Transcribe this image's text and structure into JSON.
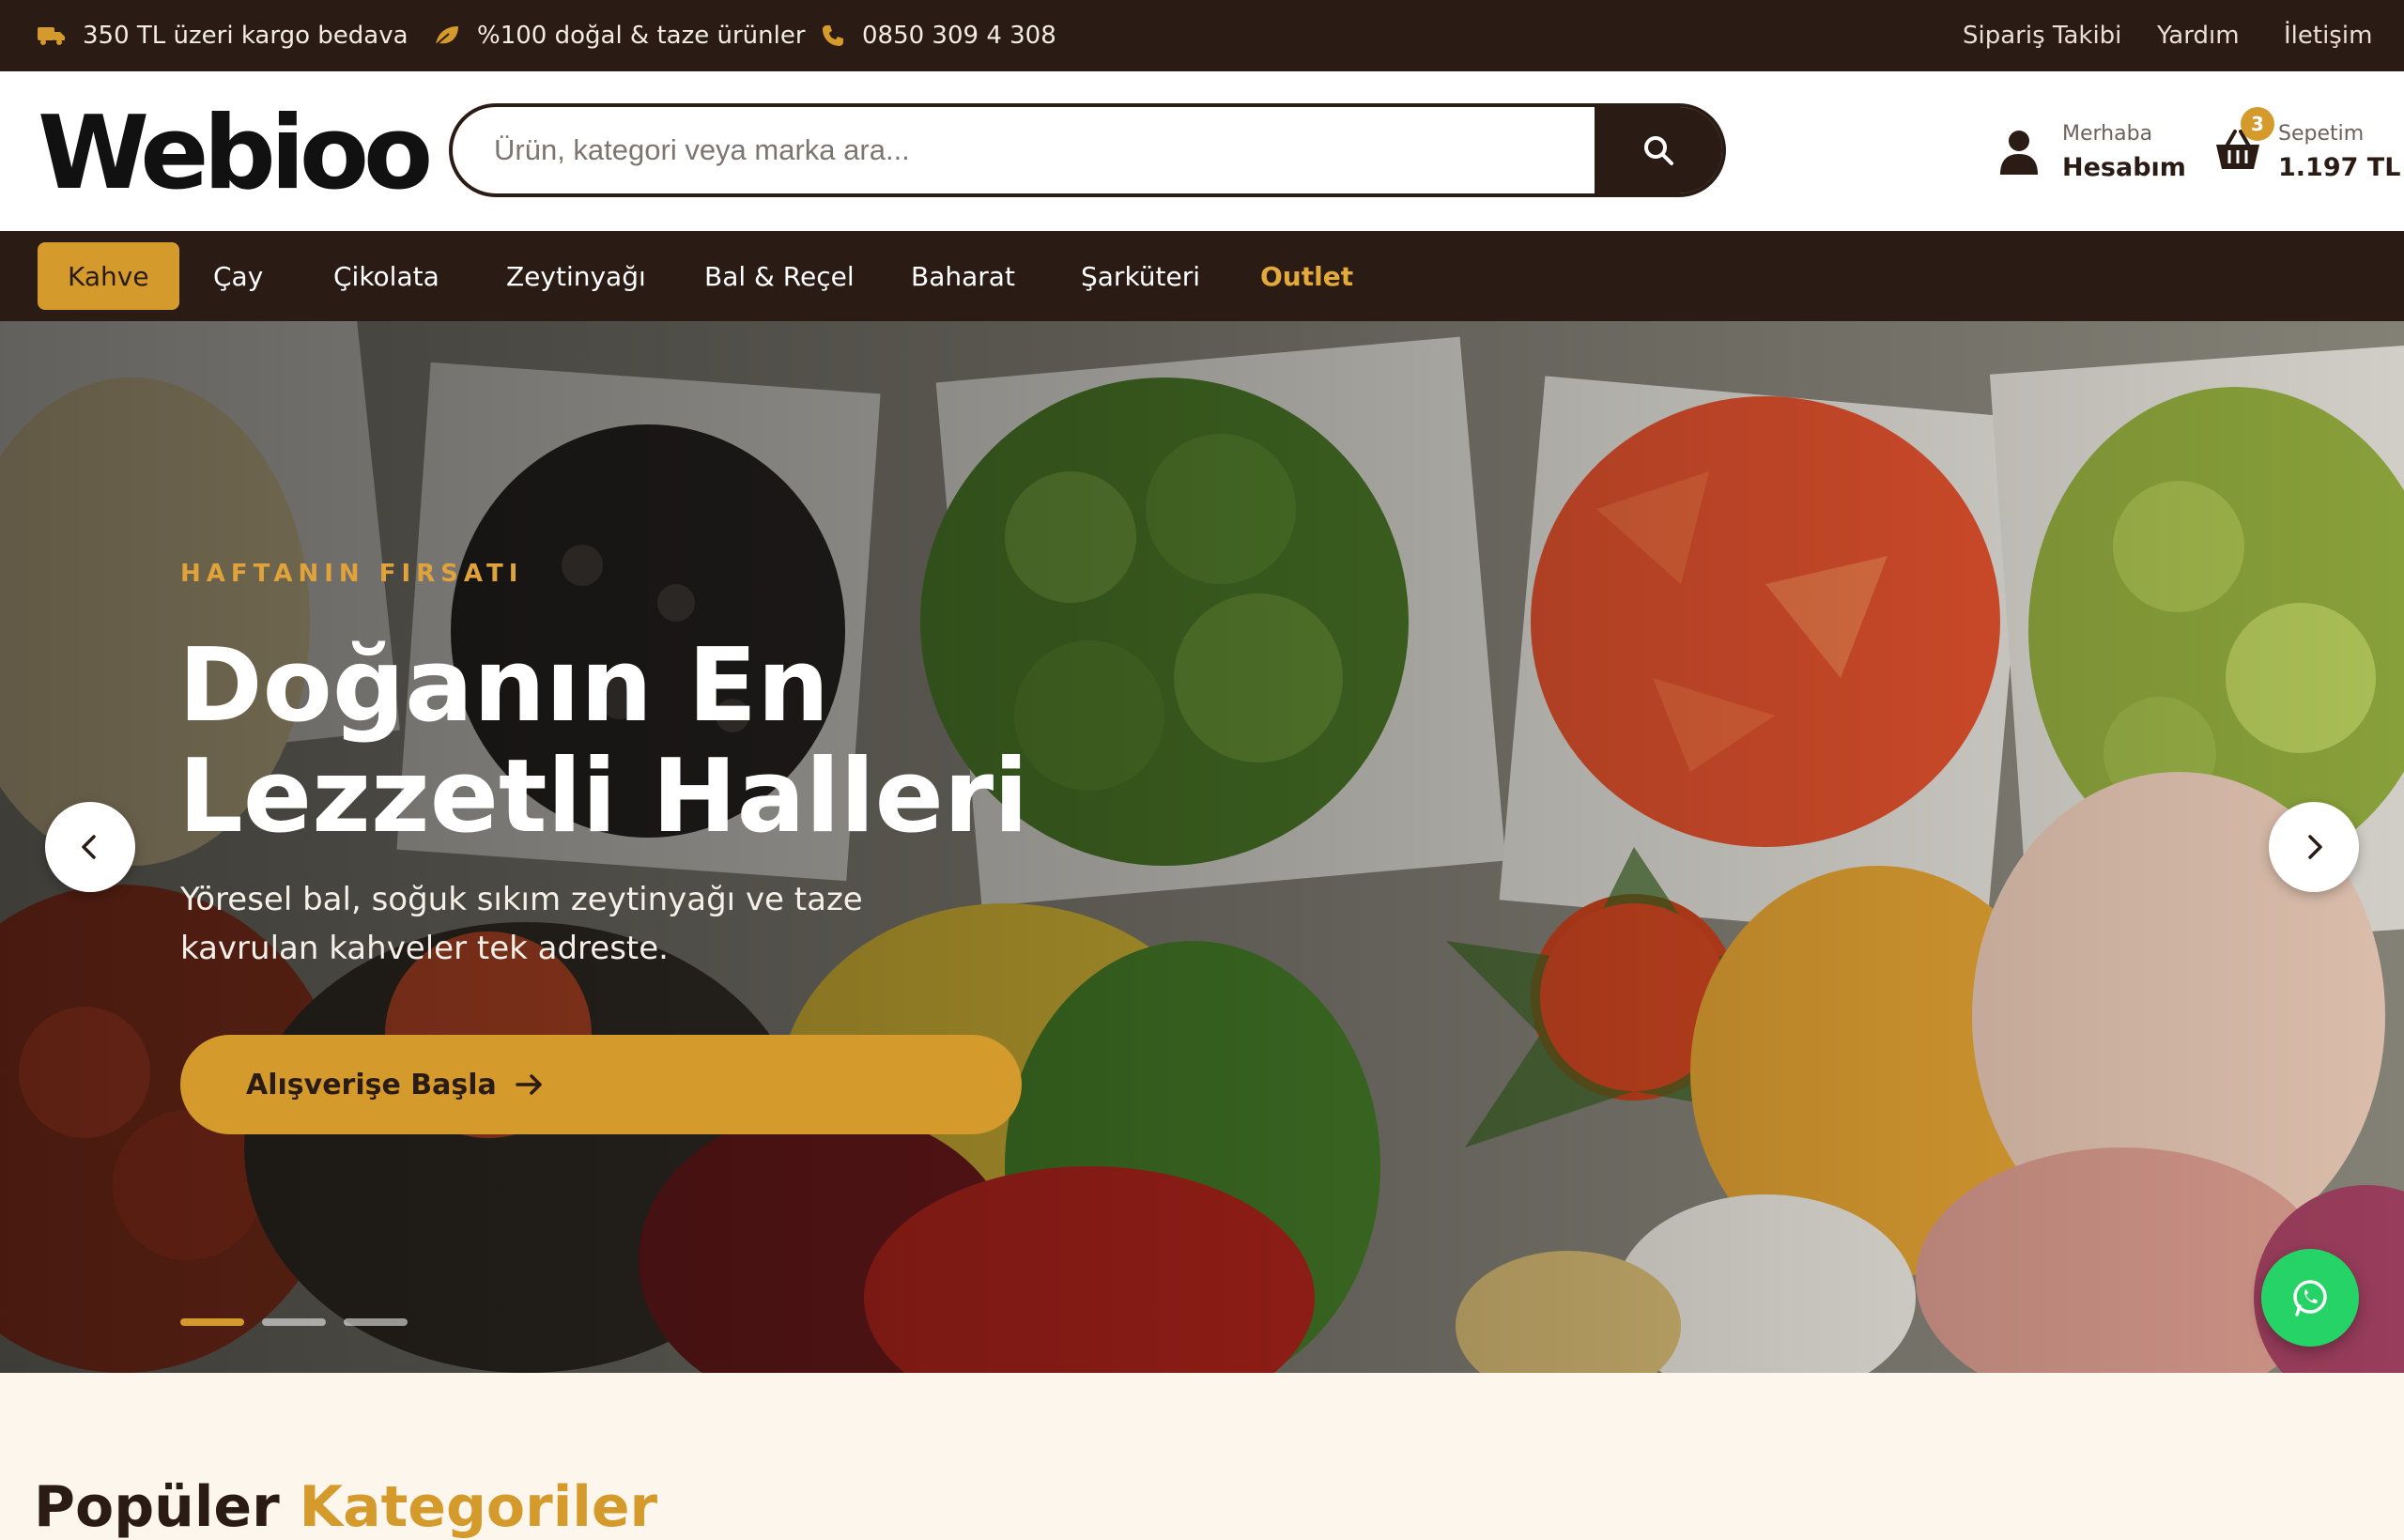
{
  "topbar": {
    "shipping": "350 TL üzeri kargo bedava",
    "natural": "%100 doğal & taze ürünler",
    "phone": "0850 309 4 308",
    "links": [
      "Sipariş Takibi",
      "Yardım",
      "İletişim"
    ],
    "icons": [
      "truck-icon",
      "leaf-icon",
      "phone-icon"
    ]
  },
  "header": {
    "logo": "Webioo",
    "search_placeholder": "Ürün, kategori veya marka ara...",
    "account_greeting": "Merhaba",
    "account_label": "Hesabım",
    "cart_label": "Sepetim",
    "cart_total": "1.197 TL",
    "cart_count": "3"
  },
  "nav": {
    "items": [
      "Kahve",
      "Çay",
      "Çikolata",
      "Zeytinyağı",
      "Bal & Reçel",
      "Baharat",
      "Şarküteri",
      "Outlet"
    ],
    "active": "Kahve"
  },
  "hero": {
    "eyebrow": "HAFTANIN FIRSATI",
    "headline_line1": "Doğanın En",
    "headline_line2": "Lezzetli Halleri",
    "subtitle": "Yöresel bal, soğuk sıkım zeytinyağı ve taze kavrulan kahveler tek adreste.",
    "cta": "Alışverişe Başla",
    "slide_count": 3,
    "active_slide": 1
  },
  "section": {
    "title_part1": "Popüler",
    "title_part2": "Kategoriler"
  },
  "colors": {
    "dark": "#2a1b14",
    "accent": "#d49a2b",
    "cream": "#fdf6ec",
    "whatsapp": "#25d366"
  }
}
